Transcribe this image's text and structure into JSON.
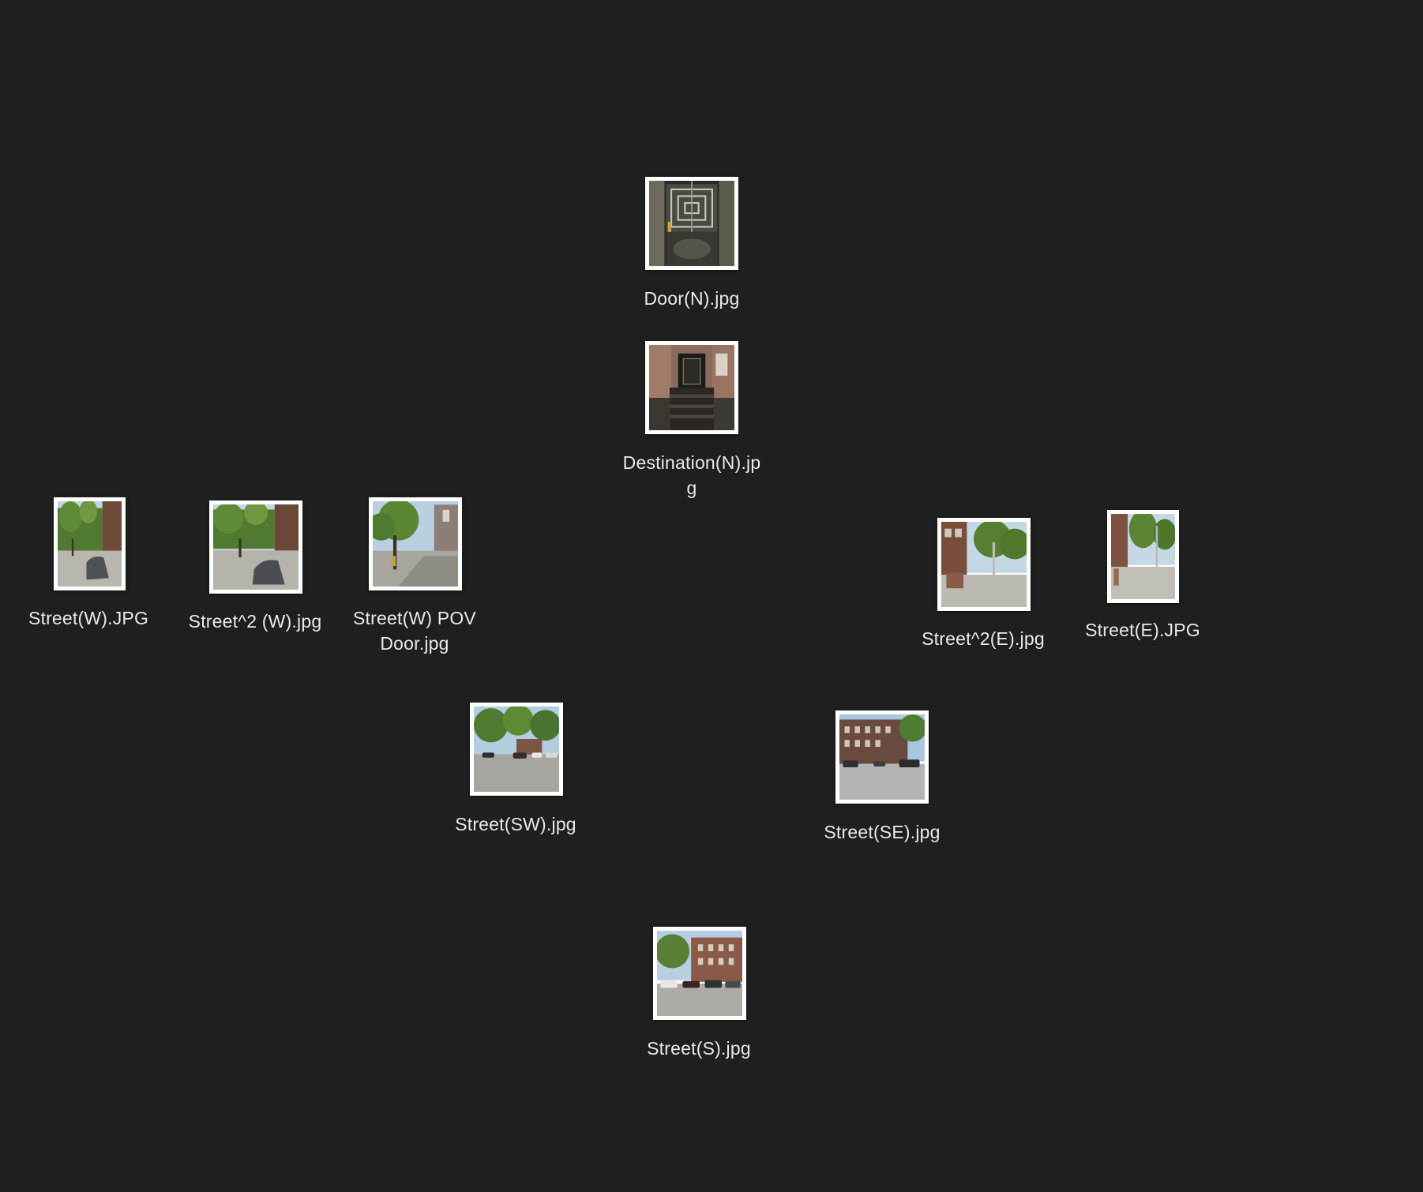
{
  "desktop": {
    "background_color": "#1f1f1f",
    "files": [
      {
        "id": "door-n",
        "name": "Door(N).jpg",
        "icon": "photo-thumbnail-icon",
        "scene": "gate"
      },
      {
        "id": "destination-n",
        "name": "Destination(N).jp\ng",
        "icon": "photo-thumbnail-icon",
        "scene": "stoop"
      },
      {
        "id": "street-w",
        "name": "Street(W).JPG",
        "icon": "photo-thumbnail-icon",
        "scene": "street-trees-left"
      },
      {
        "id": "street2-w",
        "name": "Street^2 (W).jpg",
        "icon": "photo-thumbnail-icon",
        "scene": "street-trees-left"
      },
      {
        "id": "street-w-pov-door",
        "name": "Street(W) POV\nDoor.jpg",
        "icon": "photo-thumbnail-icon",
        "scene": "sidewalk-tree"
      },
      {
        "id": "street2-e",
        "name": "Street^2(E).jpg",
        "icon": "photo-thumbnail-icon",
        "scene": "street-trees-right"
      },
      {
        "id": "street-e",
        "name": "Street(E).JPG",
        "icon": "photo-thumbnail-icon",
        "scene": "street-trees-right"
      },
      {
        "id": "street-sw",
        "name": "Street(SW).jpg",
        "icon": "photo-thumbnail-icon",
        "scene": "parked-cars-trees"
      },
      {
        "id": "street-se",
        "name": "Street(SE).jpg",
        "icon": "photo-thumbnail-icon",
        "scene": "parked-cars-building"
      },
      {
        "id": "street-s",
        "name": "Street(S).jpg",
        "icon": "photo-thumbnail-icon",
        "scene": "parked-cars-building"
      }
    ]
  }
}
